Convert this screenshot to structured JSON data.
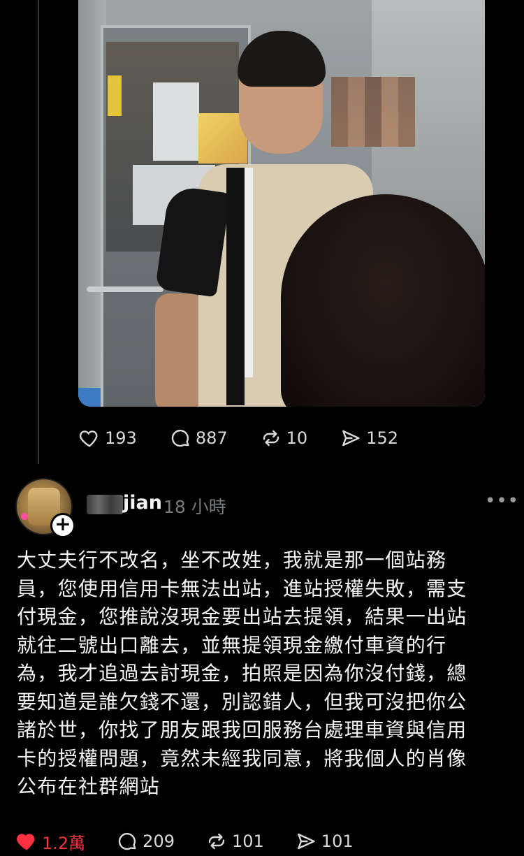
{
  "post": {
    "likes": "193",
    "comments": "887",
    "reposts": "10",
    "shares": "152"
  },
  "reply": {
    "username": "jian",
    "time": "18 小時",
    "more": "•••",
    "follow_plus": "+",
    "text_lines": [
      "大丈夫行不改名，坐不改姓，我就是那一個站務",
      "員，您使用信用卡無法出站，進站授權失敗，需支",
      "付現金，您推說沒現金要出站去提領，結果一出站",
      "就往二號出口離去，並無提領現金繳付車資的行",
      "為，我才追過去討現金，拍照是因為你沒付錢，總",
      "要知道是誰欠錢不還，別認錯人，但我可沒把你公",
      "諸於世，你找了朋友跟我回服務台處理車資與信用",
      "卡的授權問題，竟然未經我同意，將我個人的肖像",
      "公布在社群網站"
    ],
    "likes": "1.2萬",
    "comments": "209",
    "reposts": "101",
    "shares": "101"
  },
  "icons": {
    "like": "heart-icon",
    "liked": "heart-filled-icon",
    "comment": "comment-bubble-icon",
    "repost": "repost-icon",
    "share": "send-icon"
  },
  "colors": {
    "background": "#000000",
    "text": "#f3f5f7",
    "muted": "#777a7d",
    "liked": "#ff3040"
  }
}
